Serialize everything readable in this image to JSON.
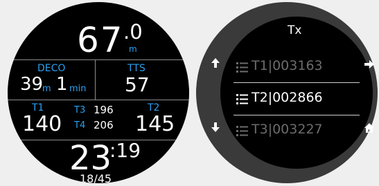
{
  "left_screen": {
    "depth_main": "67",
    "depth_decimal": ".0",
    "depth_unit": "m",
    "deco_label": "DECO",
    "deco_depth": "39",
    "deco_depth_unit": "m",
    "deco_time": "1",
    "deco_time_unit": "min",
    "tts_label": "TTS",
    "tts_value": "57",
    "t1_label": "T1",
    "t1_value": "140",
    "t2_label": "T2",
    "t2_value": "145",
    "t3_label": "T3",
    "t3_value": "196",
    "t4_label": "T4",
    "t4_value": "206",
    "dive_time_main": "23",
    "dive_time_seconds": ":19",
    "gas_mix": "18/45"
  },
  "right_screen": {
    "title": "Tx",
    "items": [
      {
        "label": "T1|003163",
        "state": "dim"
      },
      {
        "label": "T2|002866",
        "state": "selected"
      },
      {
        "label": "T3|003227",
        "state": "dim"
      }
    ],
    "buttons": {
      "up_icon": "arrow-up-icon",
      "right_icon": "arrow-right-icon",
      "down_icon": "arrow-down-icon",
      "home_icon": "home-icon"
    }
  },
  "colors": {
    "background": "#efefef",
    "screen": "#000000",
    "bezel": "#3a3a3a",
    "accent_blue": "#2aa0f0",
    "text_white": "#ffffff",
    "text_dim": "#6c6c6c"
  }
}
